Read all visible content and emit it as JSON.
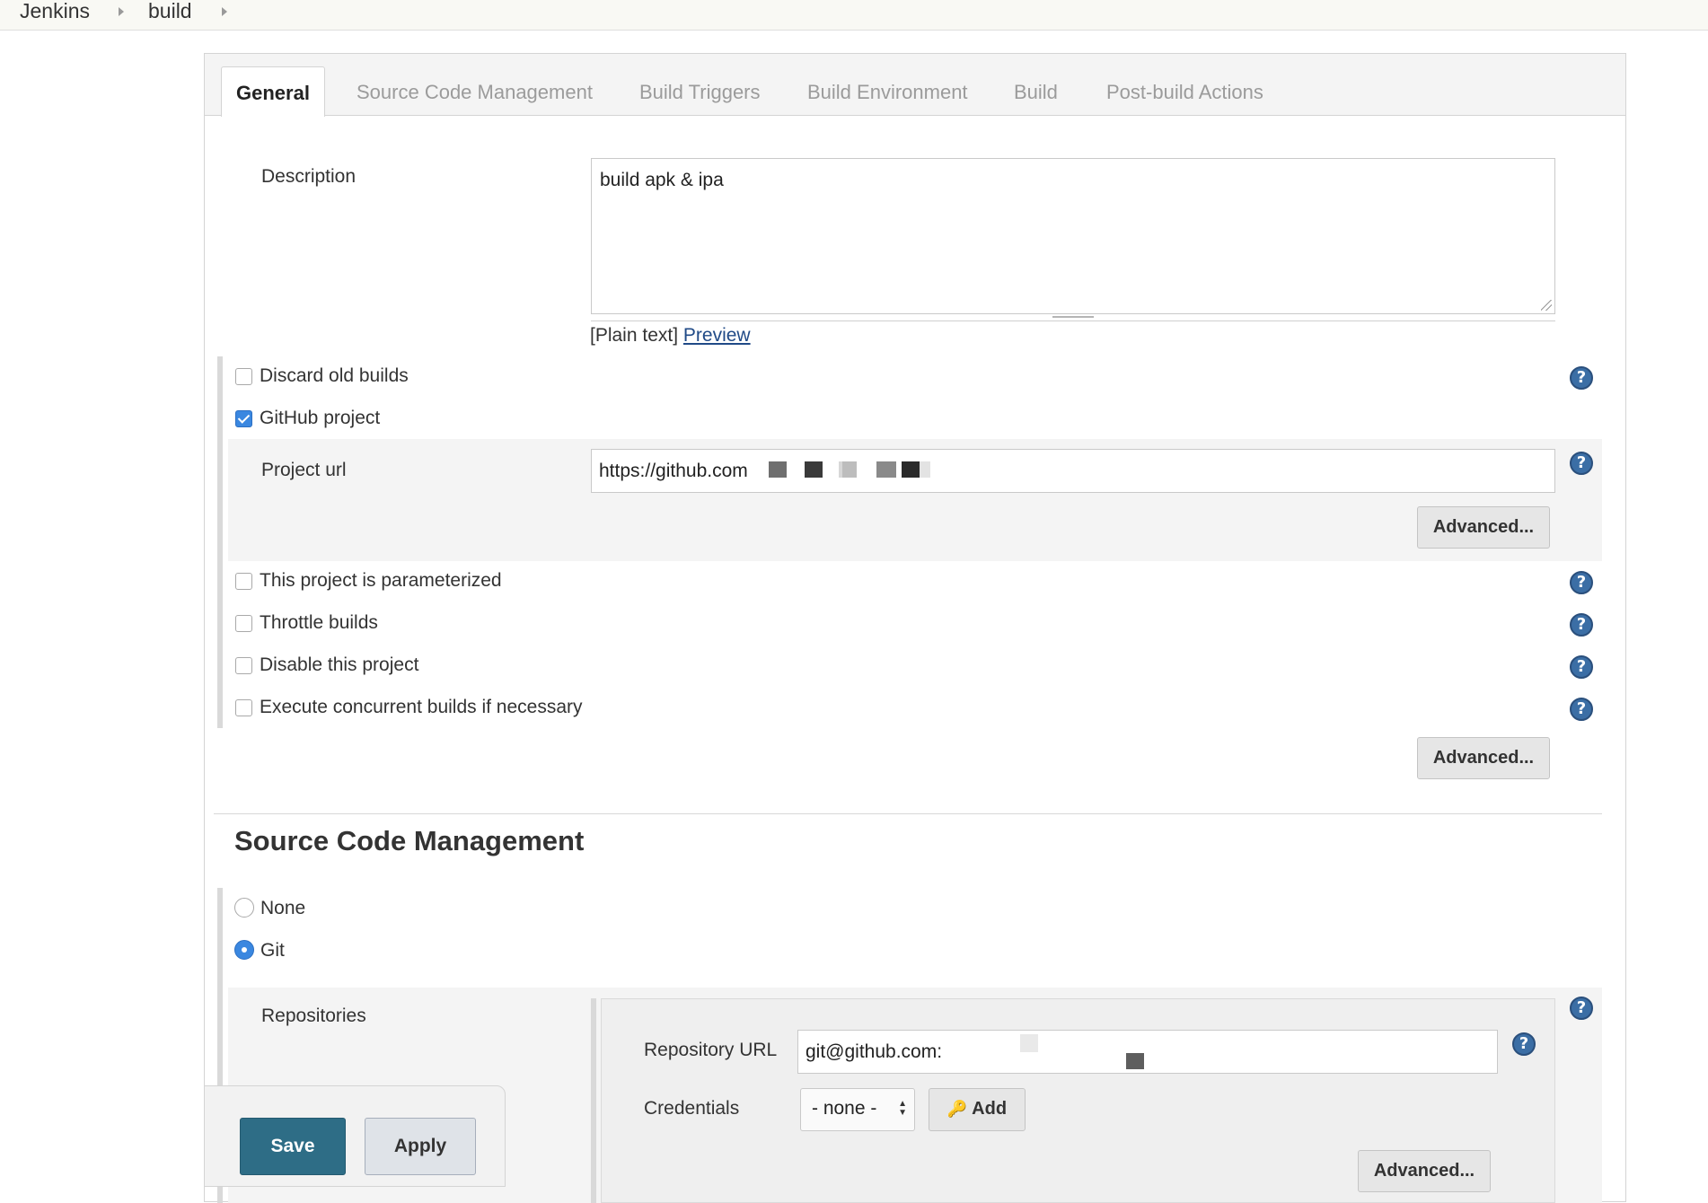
{
  "breadcrumb": {
    "items": [
      "Jenkins",
      "build"
    ]
  },
  "tabs": [
    {
      "label": "General",
      "active": true
    },
    {
      "label": "Source Code Management",
      "active": false
    },
    {
      "label": "Build Triggers",
      "active": false
    },
    {
      "label": "Build Environment",
      "active": false
    },
    {
      "label": "Build",
      "active": false
    },
    {
      "label": "Post-build Actions",
      "active": false
    }
  ],
  "general": {
    "description_label": "Description",
    "description_value": "build apk & ipa",
    "plain_text_label": "[Plain text]",
    "preview_link": "Preview",
    "discard_old_builds": {
      "label": "Discard old builds",
      "checked": false
    },
    "github_project": {
      "label": "GitHub project",
      "checked": true
    },
    "project_url_label": "Project url",
    "project_url_value": "https://github.com",
    "advanced_label": "Advanced...",
    "parameterized": {
      "label": "This project is parameterized",
      "checked": false
    },
    "throttle_builds": {
      "label": "Throttle builds",
      "checked": false
    },
    "disable_project": {
      "label": "Disable this project",
      "checked": false
    },
    "concurrent_builds": {
      "label": "Execute concurrent builds if necessary",
      "checked": false
    },
    "advanced_label_2": "Advanced..."
  },
  "scm": {
    "title": "Source Code Management",
    "none_label": "None",
    "git_label": "Git",
    "selected": "Git",
    "repositories_label": "Repositories",
    "repository_url_label": "Repository URL",
    "repository_url_value": "git@github.com:",
    "credentials_label": "Credentials",
    "credentials_selected": "- none -",
    "add_label": "Add",
    "advanced_label": "Advanced..."
  },
  "footer": {
    "save_label": "Save",
    "apply_label": "Apply"
  },
  "colors": {
    "accent": "#3a87e0",
    "save_button": "#2e6d86",
    "help_icon": "#3b6ea5"
  }
}
